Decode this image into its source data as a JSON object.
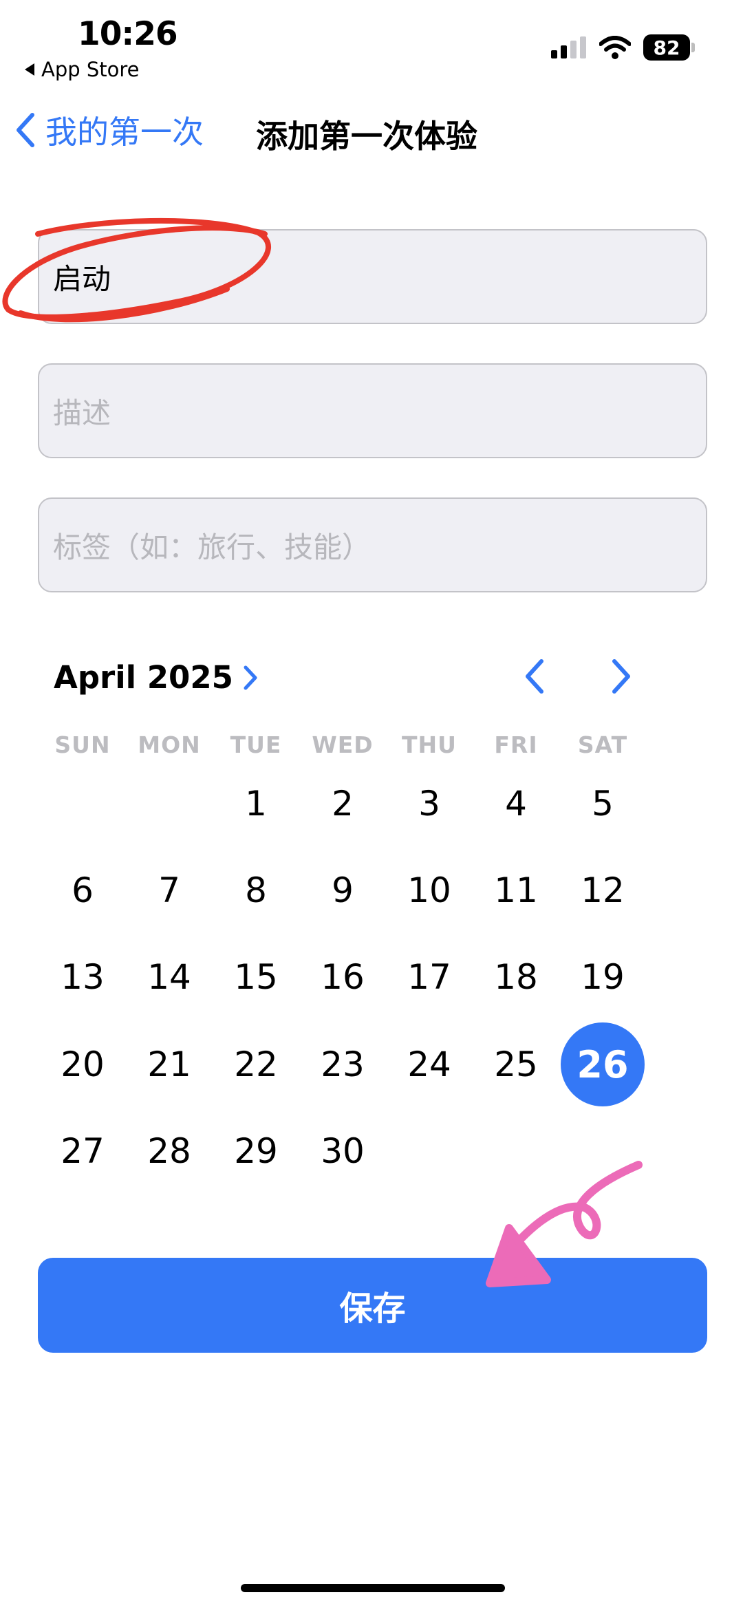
{
  "status_bar": {
    "time": "10:26",
    "back_app": "App Store",
    "battery": "82"
  },
  "nav": {
    "back_label": "我的第一次",
    "title": "添加第一次体验"
  },
  "form": {
    "title_value": "启动",
    "description_placeholder": "描述",
    "tags_placeholder": "标签（如：旅行、技能）"
  },
  "calendar": {
    "month_label": "April 2025",
    "weekdays": [
      "SUN",
      "MON",
      "TUE",
      "WED",
      "THU",
      "FRI",
      "SAT"
    ],
    "weeks": [
      [
        "",
        "",
        "1",
        "2",
        "3",
        "4",
        "5"
      ],
      [
        "6",
        "7",
        "8",
        "9",
        "10",
        "11",
        "12"
      ],
      [
        "13",
        "14",
        "15",
        "16",
        "17",
        "18",
        "19"
      ],
      [
        "20",
        "21",
        "22",
        "23",
        "24",
        "25",
        "26"
      ],
      [
        "27",
        "28",
        "29",
        "30",
        "",
        "",
        ""
      ]
    ],
    "selected_day": "26",
    "accent_color": "#3478F6"
  },
  "save_label": "保存"
}
